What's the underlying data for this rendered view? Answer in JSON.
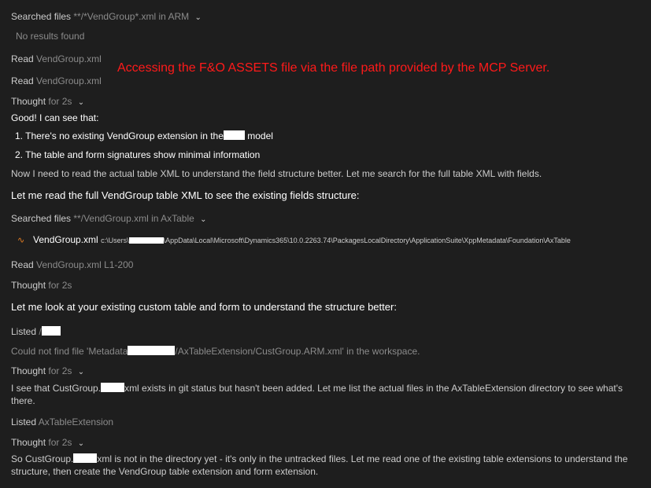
{
  "log": {
    "searched1": {
      "verb": "Searched files",
      "detail": "**/*VendGroup*.xml in ARM"
    },
    "no_results": "No results found",
    "read1": {
      "verb": "Read",
      "detail": "VendGroup.xml"
    },
    "read2": {
      "verb": "Read",
      "detail": "VendGroup.xml"
    },
    "thought1": {
      "verb": "Thought",
      "detail": "for 2s"
    },
    "good": "Good! I can see that:",
    "list1_pre": "1. There's no existing VendGroup extension in the",
    "list1_post": "model",
    "list2": "2. The table and form signatures show minimal information",
    "now_text": "Now I need to read the actual table XML to understand the field structure better. Let me search for the full table XML with fields.",
    "let_read": "Let me read the full VendGroup table XML to see the existing fields structure:",
    "searched2": {
      "verb": "Searched files",
      "detail": "**/VendGroup.xml in AxTable"
    },
    "file_result": {
      "name": "VendGroup.xml",
      "path_prefix": "c:\\Users\\",
      "path_suffix": "\\AppData\\Local\\Microsoft\\Dynamics365\\10.0.2263.74\\PackagesLocalDirectory\\ApplicationSuite\\XppMetadata\\Foundation\\AxTable"
    },
    "read3": {
      "verb": "Read",
      "detail": "VendGroup.xml L1-200"
    },
    "thought2": {
      "verb": "Thought",
      "detail": "for 2s"
    },
    "let_look": "Let me look at your existing custom table and form to understand the structure better:",
    "listed1": {
      "verb": "Listed",
      "detail": "/"
    },
    "could_not": {
      "pre": "Could not find file 'Metadata",
      "post": "/AxTableExtension/CustGroup.ARM.xml' in the workspace."
    },
    "thought3": {
      "verb": "Thought",
      "detail": "for 2s"
    },
    "see_that": {
      "pre": "I see that CustGroup.",
      "post": "xml exists in git status but hasn't been added. Let me list the actual files in the AxTableExtension directory to see what's there."
    },
    "listed2": {
      "verb": "Listed",
      "detail": "AxTableExtension"
    },
    "thought4": {
      "verb": "Thought",
      "detail": "for 2s"
    },
    "so_cust": {
      "pre": "So CustGroup.",
      "post": "xml is not in the directory yet - it's only in the untracked files. Let me read one of the existing table extensions to understand the structure, then create the VendGroup table extension and form extension."
    }
  },
  "annotation": "Accessing the F&O ASSETS file via the file path provided by the MCP Server.",
  "icons": {
    "chevron": "chevron-down-icon",
    "file": "rss-file-icon"
  },
  "colors": {
    "background": "#1e1e1e",
    "annotation": "#ff1a1a",
    "file_icon": "#e67e22"
  }
}
